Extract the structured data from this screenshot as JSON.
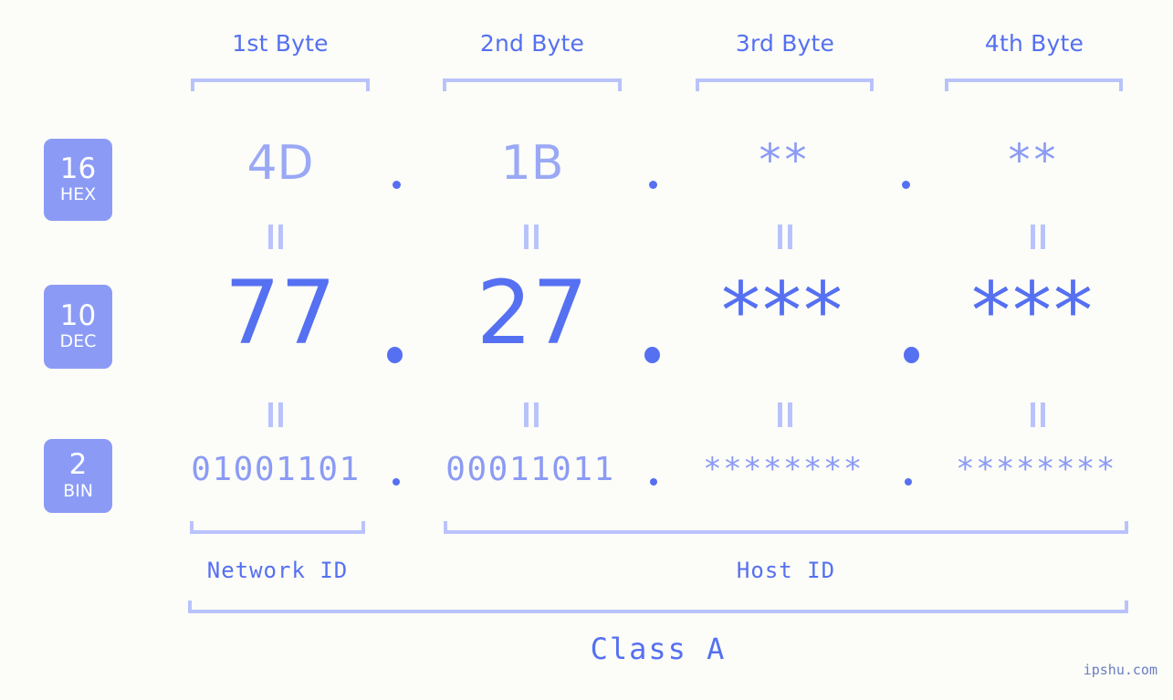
{
  "watermark": "ipshu.com",
  "byte_headers": [
    {
      "label": "1st Byte"
    },
    {
      "label": "2nd Byte"
    },
    {
      "label": "3rd Byte"
    },
    {
      "label": "4th Byte"
    }
  ],
  "bases": [
    {
      "id": "hex",
      "number": "16",
      "name": "HEX"
    },
    {
      "id": "dec",
      "number": "10",
      "name": "DEC"
    },
    {
      "id": "bin",
      "number": "2",
      "name": "BIN"
    }
  ],
  "rows": {
    "hex": {
      "base_number": "16",
      "base_name": "HEX",
      "values": [
        "4D",
        "1B",
        "**",
        "**"
      ],
      "separator": "."
    },
    "dec": {
      "base_number": "10",
      "base_name": "DEC",
      "values": [
        "77",
        "27",
        "***",
        "***"
      ],
      "separator": "."
    },
    "bin": {
      "base_number": "2",
      "base_name": "BIN",
      "values": [
        "01001101",
        "00011011",
        "********",
        "********"
      ],
      "separator": "."
    }
  },
  "equals_mark": "||",
  "sections": {
    "network_id": "Network ID",
    "host_id": "Host ID",
    "class": "Class A"
  },
  "colors": {
    "background": "#fcfdf8",
    "strong_blue": "#5570f1",
    "mid_blue": "#8b9bf5",
    "light_blue": "#b9c3fb",
    "badge_text": "#ffffff"
  }
}
